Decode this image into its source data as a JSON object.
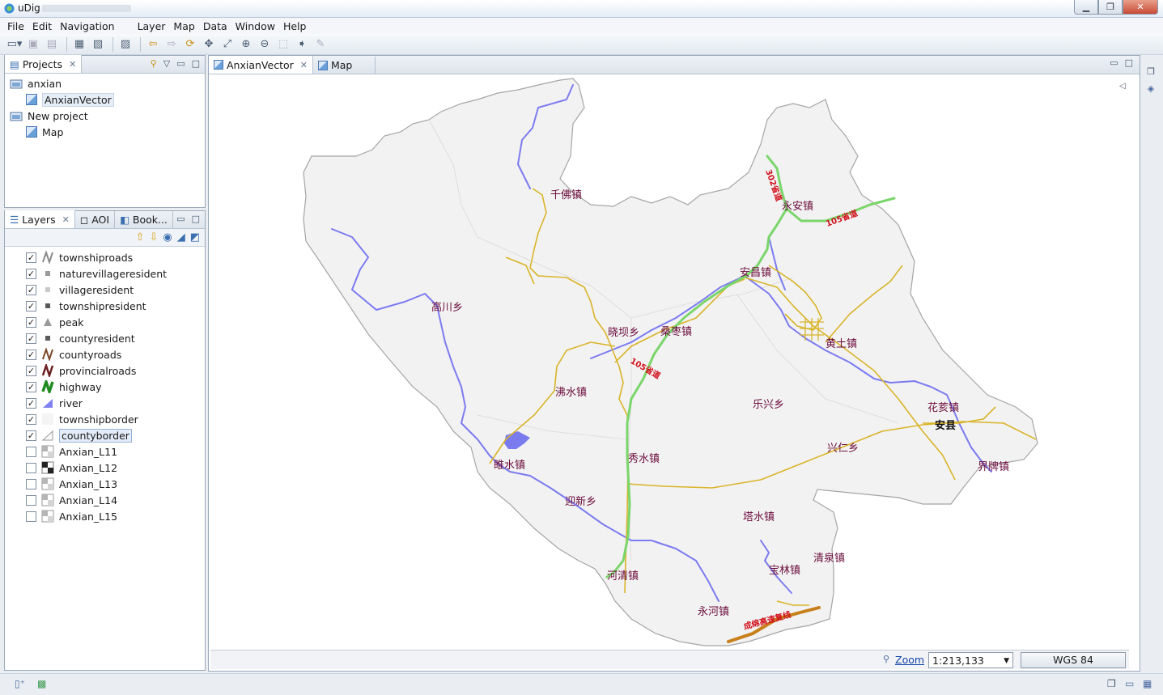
{
  "window": {
    "title": "uDig"
  },
  "menu": [
    "File",
    "Edit",
    "Navigation",
    "Layer",
    "Map",
    "Data",
    "Window",
    "Help"
  ],
  "projects_panel": {
    "tab": "Projects",
    "items": [
      {
        "label": "anxian",
        "type": "project"
      },
      {
        "label": "AnxianVector",
        "type": "map",
        "selected": true
      },
      {
        "label": "New project",
        "type": "project"
      },
      {
        "label": "Map",
        "type": "map"
      }
    ]
  },
  "layers_panel": {
    "tabs": [
      "Layers",
      "AOI",
      "Book..."
    ],
    "layers": [
      {
        "label": "townshiproads",
        "checked": true,
        "icon": "line-gray"
      },
      {
        "label": "naturevillageresident",
        "checked": true,
        "icon": "point-gray"
      },
      {
        "label": "villageresident",
        "checked": true,
        "icon": "point-lightgray"
      },
      {
        "label": "townshipresident",
        "checked": true,
        "icon": "point-dark"
      },
      {
        "label": "peak",
        "checked": true,
        "icon": "triangle-gray"
      },
      {
        "label": "countyresident",
        "checked": true,
        "icon": "point-dark"
      },
      {
        "label": "countyroads",
        "checked": true,
        "icon": "line-brown"
      },
      {
        "label": "provincialroads",
        "checked": true,
        "icon": "line-darkred"
      },
      {
        "label": "highway",
        "checked": true,
        "icon": "line-green"
      },
      {
        "label": "river",
        "checked": true,
        "icon": "polygon-blue"
      },
      {
        "label": "townshipborder",
        "checked": true,
        "icon": "polygon-white"
      },
      {
        "label": "countyborder",
        "checked": true,
        "icon": "polygon-outline",
        "selected": true
      },
      {
        "label": "Anxian_L11",
        "checked": false,
        "icon": "raster"
      },
      {
        "label": "Anxian_L12",
        "checked": false,
        "icon": "raster-dark"
      },
      {
        "label": "Anxian_L13",
        "checked": false,
        "icon": "raster"
      },
      {
        "label": "Anxian_L14",
        "checked": false,
        "icon": "raster"
      },
      {
        "label": "Anxian_L15",
        "checked": false,
        "icon": "raster"
      }
    ]
  },
  "editor": {
    "tabs": [
      {
        "label": "AnxianVector",
        "active": true
      },
      {
        "label": "Map",
        "active": false
      }
    ]
  },
  "map": {
    "places": [
      {
        "name": "千佛镇"
      },
      {
        "name": "永安镇"
      },
      {
        "name": "安昌镇"
      },
      {
        "name": "高川乡"
      },
      {
        "name": "晓坝乡"
      },
      {
        "name": "桑枣镇"
      },
      {
        "name": "黄土镇"
      },
      {
        "name": "沸水镇"
      },
      {
        "name": "乐兴乡"
      },
      {
        "name": "花荄镇"
      },
      {
        "name": "安县"
      },
      {
        "name": "兴仁乡"
      },
      {
        "name": "睢水镇"
      },
      {
        "name": "秀水镇"
      },
      {
        "name": "界牌镇"
      },
      {
        "name": "迎新乡"
      },
      {
        "name": "塔水镇"
      },
      {
        "name": "清泉镇"
      },
      {
        "name": "宝林镇"
      },
      {
        "name": "河清镇"
      },
      {
        "name": "永河镇"
      }
    ],
    "road_labels": [
      "302省道",
      "105省道",
      "105省道",
      "成绵高速复线"
    ],
    "colors": {
      "land": "#f2f2f2",
      "border": "#9a9a9a",
      "river": "#7b7bf0",
      "highway": "#7ad66a",
      "county_road": "#d9b429",
      "expressway": "#c8801a"
    }
  },
  "status": {
    "zoom_label": "Zoom",
    "scale": "1:213,133",
    "crs": "WGS 84"
  }
}
